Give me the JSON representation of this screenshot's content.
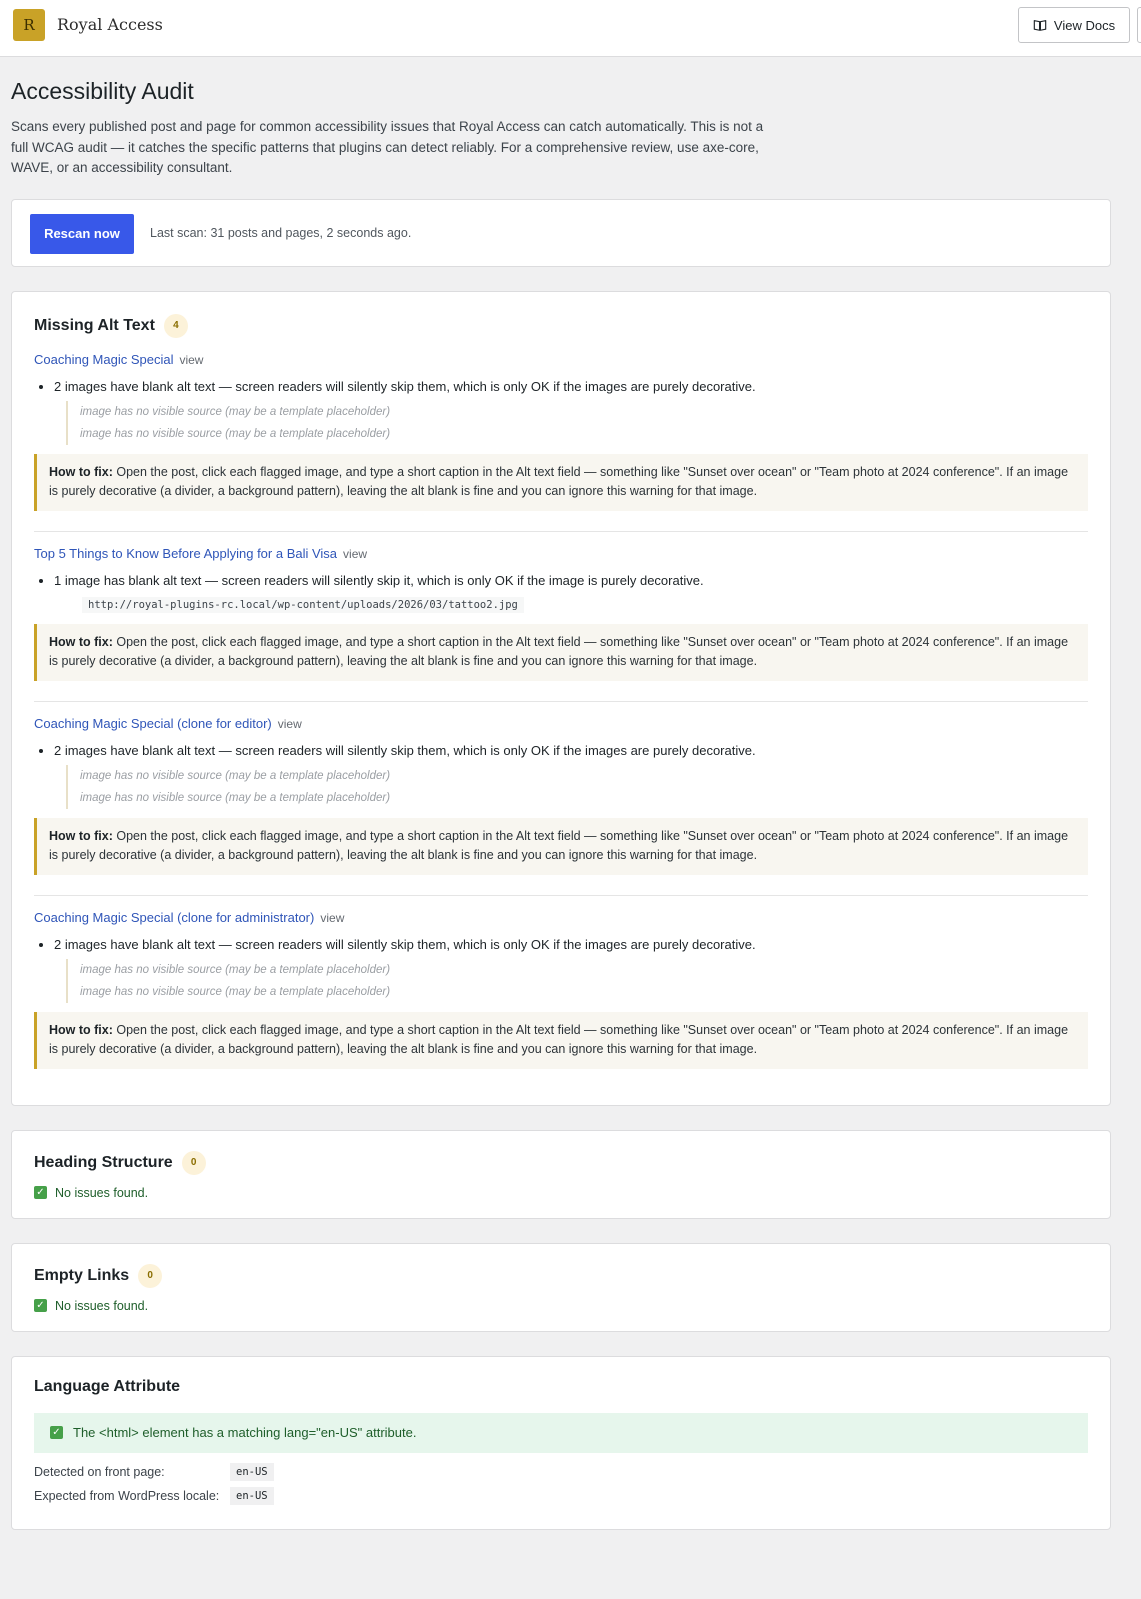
{
  "header": {
    "logo_letter": "R",
    "brand": "Royal Access",
    "docs_label": "View Docs"
  },
  "page": {
    "title": "Accessibility Audit",
    "intro": "Scans every published post and page for common accessibility issues that Royal Access can catch automatically. This is not a full WCAG audit — it catches the specific patterns that plugins can detect reliably. For a comprehensive review, use axe-core, WAVE, or an accessibility consultant."
  },
  "scan": {
    "button_label": "Rescan now",
    "last_scan": "Last scan: 31 posts and pages, 2 seconds ago."
  },
  "missing_alt": {
    "title": "Missing Alt Text",
    "count": "4",
    "view_label": "view",
    "fix_label": "How to fix:",
    "fix_text": "Open the post, click each flagged image, and type a short caption in the Alt text field — something like \"Sunset over ocean\" or \"Team photo at 2024 conference\". If an image is purely decorative (a divider, a background pattern), leaving the alt blank is fine and you can ignore this warning for that image.",
    "items": [
      {
        "post": "Coaching Magic Special",
        "message": "2 images have blank alt text — screen readers will silently skip them, which is only OK if the images are purely decorative.",
        "details": [
          "image has no visible source (may be a template placeholder)",
          "image has no visible source (may be a template placeholder)"
        ]
      },
      {
        "post": "Top 5 Things to Know Before Applying for a Bali Visa",
        "message": "1 image has blank alt text — screen readers will silently skip it, which is only OK if the image is purely decorative.",
        "url": "http://royal-plugins-rc.local/wp-content/uploads/2026/03/tattoo2.jpg"
      },
      {
        "post": "Coaching Magic Special (clone for editor)",
        "message": "2 images have blank alt text — screen readers will silently skip them, which is only OK if the images are purely decorative.",
        "details": [
          "image has no visible source (may be a template placeholder)",
          "image has no visible source (may be a template placeholder)"
        ]
      },
      {
        "post": "Coaching Magic Special (clone for administrator)",
        "message": "2 images have blank alt text — screen readers will silently skip them, which is only OK if the images are purely decorative.",
        "details": [
          "image has no visible source (may be a template placeholder)",
          "image has no visible source (may be a template placeholder)"
        ]
      }
    ]
  },
  "heading_structure": {
    "title": "Heading Structure",
    "count": "0",
    "status": "No issues found."
  },
  "empty_links": {
    "title": "Empty Links",
    "count": "0",
    "status": "No issues found."
  },
  "language": {
    "title": "Language Attribute",
    "status": "The <html> element has a matching lang=\"en-US\" attribute.",
    "detected_label": "Detected on front page:",
    "detected_value": "en-US",
    "expected_label": "Expected from WordPress locale:",
    "expected_value": "en-US"
  },
  "colors": {
    "accent": "#3858e9",
    "brand_gold": "#c9a227",
    "link": "#2f55b8",
    "success": "#46a049"
  },
  "icons": {
    "logo": "royal-access-logo",
    "docs": "book-icon",
    "ok": "checkmark-icon"
  }
}
